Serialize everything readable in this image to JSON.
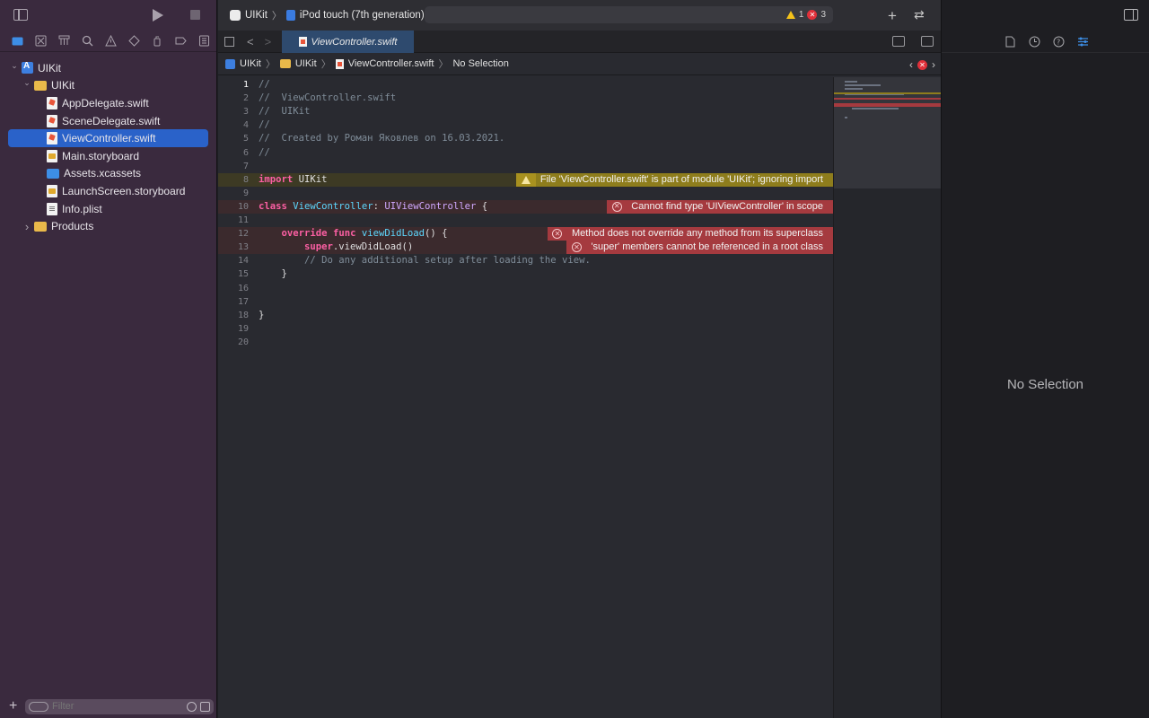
{
  "scheme": {
    "target": "UIKit",
    "device": "iPod touch (7th generation)"
  },
  "activity": {
    "warning_count": "1",
    "error_count": "3"
  },
  "navigator": {
    "items": [
      {
        "label": "UIKit",
        "kind": "project",
        "depth": 0,
        "disclosure": "expanded"
      },
      {
        "label": "UIKit",
        "kind": "folder",
        "depth": 1,
        "disclosure": "expanded"
      },
      {
        "label": "AppDelegate.swift",
        "kind": "swift",
        "depth": 2
      },
      {
        "label": "SceneDelegate.swift",
        "kind": "swift",
        "depth": 2
      },
      {
        "label": "ViewController.swift",
        "kind": "swift",
        "depth": 2,
        "selected": true
      },
      {
        "label": "Main.storyboard",
        "kind": "storyboard",
        "depth": 2
      },
      {
        "label": "Assets.xcassets",
        "kind": "assets",
        "depth": 2
      },
      {
        "label": "LaunchScreen.storyboard",
        "kind": "storyboard",
        "depth": 2
      },
      {
        "label": "Info.plist",
        "kind": "plist",
        "depth": 2
      },
      {
        "label": "Products",
        "kind": "folder",
        "depth": 1,
        "disclosure": "collapsed"
      }
    ],
    "filter_placeholder": "Filter"
  },
  "editor": {
    "tab_title": "ViewController.swift",
    "jumpbar": {
      "project": "UIKit",
      "group": "UIKit",
      "file": "ViewController.swift",
      "symbol": "No Selection"
    }
  },
  "code_lines": [
    {
      "n": "1",
      "tokens": [
        [
          "cm",
          "//"
        ]
      ],
      "current": true
    },
    {
      "n": "2",
      "tokens": [
        [
          "cm",
          "//  ViewController.swift"
        ]
      ]
    },
    {
      "n": "3",
      "tokens": [
        [
          "cm",
          "//  UIKit"
        ]
      ]
    },
    {
      "n": "4",
      "tokens": [
        [
          "cm",
          "//"
        ]
      ]
    },
    {
      "n": "5",
      "tokens": [
        [
          "cm",
          "//  Created by Роман Яковлев on 16.03.2021."
        ]
      ]
    },
    {
      "n": "6",
      "tokens": [
        [
          "cm",
          "//"
        ]
      ]
    },
    {
      "n": "7",
      "tokens": []
    },
    {
      "n": "8",
      "tokens": [
        [
          "kw",
          "import"
        ],
        [
          "pl",
          " UIKit"
        ]
      ],
      "issue": {
        "type": "warn",
        "text": "File 'ViewController.swift' is part of module 'UIKit'; ignoring import"
      }
    },
    {
      "n": "9",
      "tokens": []
    },
    {
      "n": "10",
      "tokens": [
        [
          "kw",
          "class"
        ],
        [
          "pl",
          " "
        ],
        [
          "ty",
          "ViewController"
        ],
        [
          "pl",
          ": "
        ],
        [
          "ty2",
          "UIViewController"
        ],
        [
          "pl",
          " {"
        ]
      ],
      "issue": {
        "type": "err",
        "text": "Cannot find type 'UIViewController' in scope"
      }
    },
    {
      "n": "11",
      "tokens": []
    },
    {
      "n": "12",
      "tokens": [
        [
          "pl",
          "    "
        ],
        [
          "kw",
          "override"
        ],
        [
          "pl",
          " "
        ],
        [
          "kw",
          "func"
        ],
        [
          "pl",
          " "
        ],
        [
          "ty",
          "viewDidLoad"
        ],
        [
          "pl",
          "() {"
        ]
      ],
      "issue": {
        "type": "err",
        "text": "Method does not override any method from its superclass"
      }
    },
    {
      "n": "13",
      "tokens": [
        [
          "pl",
          "        "
        ],
        [
          "kw",
          "super"
        ],
        [
          "pl",
          ".viewDidLoad()"
        ]
      ],
      "issue": {
        "type": "err",
        "text": "'super' members cannot be referenced in a root class"
      }
    },
    {
      "n": "14",
      "tokens": [
        [
          "pl",
          "        "
        ],
        [
          "cm",
          "// Do any additional setup after loading the view."
        ]
      ]
    },
    {
      "n": "15",
      "tokens": [
        [
          "pl",
          "    }"
        ]
      ]
    },
    {
      "n": "16",
      "tokens": []
    },
    {
      "n": "17",
      "tokens": []
    },
    {
      "n": "18",
      "tokens": [
        [
          "pl",
          "}"
        ]
      ]
    },
    {
      "n": "19",
      "tokens": []
    },
    {
      "n": "20",
      "tokens": []
    }
  ],
  "inspector": {
    "empty_text": "No Selection"
  },
  "colors": {
    "navigator_bg": "#3a2a3e",
    "editor_bg": "#292a30",
    "selection_blue": "#2a62c9",
    "warning_yellow": "#8e7d1c",
    "error_red": "#a53a3f"
  }
}
